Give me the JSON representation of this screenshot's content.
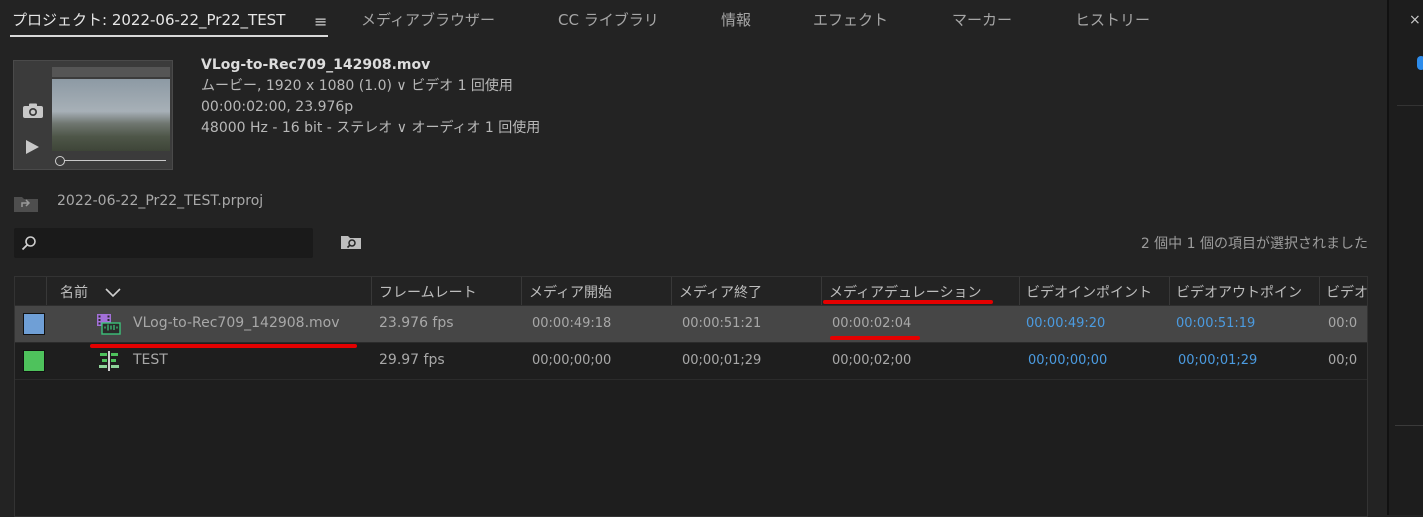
{
  "tabs": {
    "project": "プロジェクト: 2022-06-22_Pr22_TEST",
    "media_browser": "メディアブラウザー",
    "cc_library": "CC ライブラリ",
    "info": "情報",
    "effects": "エフェクト",
    "markers": "マーカー",
    "history": "ヒストリー"
  },
  "preview": {
    "filename": "VLog-to-Rec709_142908.mov",
    "video_info": "ムービー, 1920 x 1080 (1.0) ∨ ビデオ 1 回使用",
    "time_info": "00:00:02:00, 23.976p",
    "audio_info": "48000 Hz - 16 bit - ステレオ ∨ オーディオ 1 回使用"
  },
  "bin_path": "2022-06-22_Pr22_TEST.prproj",
  "search": {
    "value": "",
    "placeholder": ""
  },
  "selection_status": "2 個中 1 個の項目が選択されました",
  "columns": {
    "name": "名前",
    "frame_rate": "フレームレート",
    "media_start": "メディア開始",
    "media_end": "メディア終了",
    "media_duration": "メディアデュレーション",
    "video_in": "ビデオインポイント",
    "video_out": "ビデオアウトポイン",
    "video_more": "ビデオ"
  },
  "rows": [
    {
      "color": "#6f9fd6",
      "icon": "video-clip-icon",
      "name": "VLog-to-Rec709_142908.mov",
      "frame_rate": "23.976 fps",
      "media_start": "00:00:49:18",
      "media_end": "00:00:51:21",
      "media_duration": "00:00:02:04",
      "video_in": "00:00:49:20",
      "video_out": "00:00:51:19",
      "video_more": "00:0"
    },
    {
      "color": "#4ec25c",
      "icon": "sequence-icon",
      "name": "TEST",
      "frame_rate": "29.97 fps",
      "media_start": "00;00;00;00",
      "media_end": "00;00;01;29",
      "media_duration": "00;00;02;00",
      "video_in": "00;00;00;00",
      "video_out": "00;00;01;29",
      "video_more": "00;0"
    }
  ],
  "colors": {
    "accent_blue": "#4b9be0",
    "annotation_red": "#e40000"
  }
}
